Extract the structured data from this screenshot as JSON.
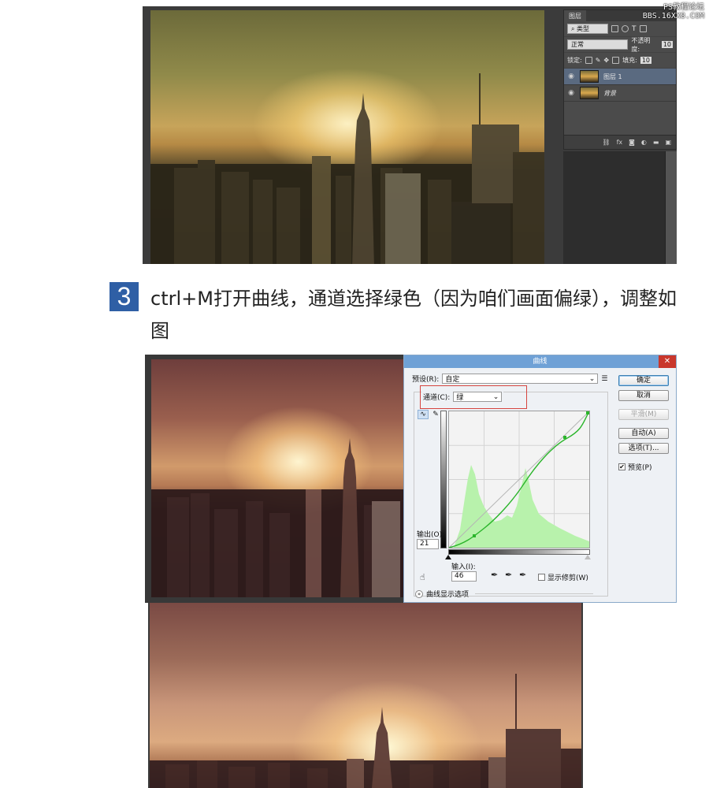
{
  "watermark": {
    "line1": "PS教程论坛",
    "line2": "BBS.16XX8.COM"
  },
  "top_shot": {
    "layers_panel": {
      "tab": "图层",
      "filter_label": "类型",
      "blend_mode": "正常",
      "opacity_label": "不透明度:",
      "opacity_value": "10",
      "lock_label": "锁定:",
      "fill_label": "填充:",
      "fill_value": "10",
      "layers": [
        {
          "name": "图层 1",
          "active": true
        },
        {
          "name": "背景",
          "active": false
        }
      ],
      "footer_icons": [
        "link-icon",
        "fx-icon",
        "mask-icon",
        "adjustment-icon",
        "folder-icon",
        "new-layer-icon",
        "trash-icon"
      ]
    }
  },
  "step": {
    "number": "3",
    "text": "ctrl+M打开曲线，通道选择绿色（因为咱们画面偏绿），调整如图"
  },
  "curves_dialog": {
    "title": "曲线",
    "preset_label": "预设(R):",
    "preset_value": "自定",
    "channel_label": "通道(C):",
    "channel_value": "绿",
    "output_label": "输出(O):",
    "output_value": "21",
    "input_label": "输入(I):",
    "input_value": "46",
    "show_clipping_label": "显示修剪(W)",
    "curve_display_label": "曲线显示选项",
    "buttons": {
      "ok": "确定",
      "cancel": "取消",
      "smooth": "平滑(M)",
      "auto": "自动(A)",
      "options": "选项(T)..."
    },
    "preview_label": "预览(P)",
    "preview_checked": true,
    "curve_points": [
      [
        0,
        0
      ],
      [
        46,
        21
      ],
      [
        136,
        115
      ],
      [
        200,
        200
      ],
      [
        255,
        255
      ]
    ],
    "accent_colors": {
      "histogram": "#b8f2ac",
      "curve": "#2bb52b",
      "highlight_box": "#d6453f"
    }
  }
}
